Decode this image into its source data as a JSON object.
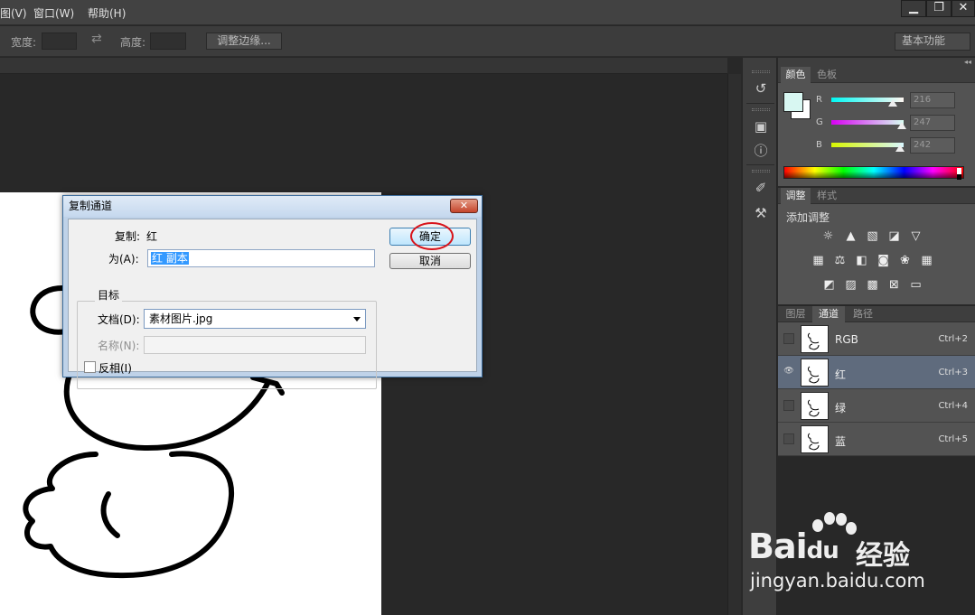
{
  "menu": {
    "items": [
      "图(V)",
      "窗口(W)",
      "帮助(H)"
    ]
  },
  "window_controls": {
    "minimize": "▁",
    "restore": "❐",
    "close": "✕"
  },
  "options_bar": {
    "width_label": "宽度:",
    "height_label": "高度:",
    "swap_icon": "⇄",
    "refine_edge_label": "调整边缘...",
    "workspace_label": "基本功能"
  },
  "icons": [
    "history-icon",
    "3d-icon",
    "info-icon",
    "brush-icon",
    "tool-presets-icon"
  ],
  "color_panel": {
    "tabs": [
      "颜色",
      "色板"
    ],
    "active_tab": "颜色",
    "foreground_color": "#d8f7f2",
    "background_color": "#ffffff",
    "channels": [
      {
        "label": "R",
        "value": "216",
        "fraction": 0.847
      },
      {
        "label": "G",
        "value": "247",
        "fraction": 0.969
      },
      {
        "label": "B",
        "value": "242",
        "fraction": 0.949
      }
    ]
  },
  "adjustments_panel": {
    "tabs": [
      "调整",
      "样式"
    ],
    "active_tab": "调整",
    "title": "添加调整"
  },
  "channels_panel": {
    "tabs": [
      "图层",
      "通道",
      "路径"
    ],
    "active_tab": "通道",
    "rows": [
      {
        "name": "RGB",
        "shortcut": "Ctrl+2",
        "visible": false,
        "selected": false
      },
      {
        "name": "红",
        "shortcut": "Ctrl+3",
        "visible": true,
        "selected": true
      },
      {
        "name": "绿",
        "shortcut": "Ctrl+4",
        "visible": false,
        "selected": false
      },
      {
        "name": "蓝",
        "shortcut": "Ctrl+5",
        "visible": false,
        "selected": false
      }
    ]
  },
  "dialog": {
    "title": "复制通道",
    "close_label": "✕",
    "copy_label": "复制:",
    "copy_value": "红",
    "as_label": "为(A):",
    "as_value": "红 副本",
    "target_label": "目标",
    "document_label": "文档(D):",
    "document_value": "素材图片.jpg",
    "name_label": "名称(N):",
    "name_value": "",
    "invert_label": "反相(I)",
    "invert_checked": false,
    "ok_label": "确定",
    "cancel_label": "取消"
  },
  "watermark": {
    "logo": "Bai",
    "logo_du": "du",
    "product": "经验",
    "url": "jingyan.baidu.com"
  }
}
